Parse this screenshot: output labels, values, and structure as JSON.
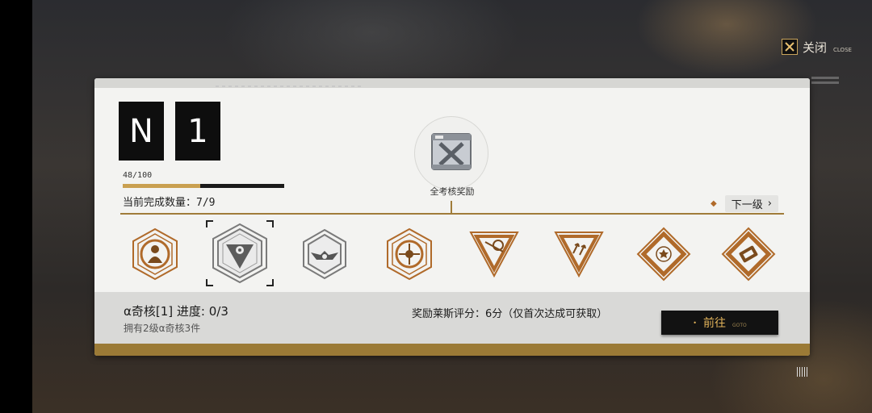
{
  "close": {
    "label": "关闭",
    "sub": "CLOSE",
    "icon": "close-icon"
  },
  "rank": {
    "letter": "N",
    "number": "1"
  },
  "progress": {
    "text": "48/100",
    "current": 48,
    "max": 100
  },
  "completion": {
    "label": "当前完成数量：",
    "value": "7/9"
  },
  "reward": {
    "label": "全考核奖励",
    "icon": "supply-crate-icon"
  },
  "next_level": {
    "label": "下一级",
    "arrow": "›"
  },
  "medals": [
    {
      "name": "person-badge-icon",
      "selected": false
    },
    {
      "name": "triangle-emblem-icon",
      "selected": true
    },
    {
      "name": "wings-emblem-icon",
      "selected": false
    },
    {
      "name": "compass-emblem-icon",
      "selected": false
    },
    {
      "name": "inverted-triangle-emblem-icon",
      "selected": false
    },
    {
      "name": "arrows-triangle-emblem-icon",
      "selected": false
    },
    {
      "name": "star-diamond-emblem-icon",
      "selected": false
    },
    {
      "name": "ticket-diamond-emblem-icon",
      "selected": false
    }
  ],
  "task": {
    "title": "α奇核[1] 进度: 0/3",
    "subtitle": "拥有2级α奇核3件",
    "reward_text": "奖励莱斯评分：6分（仅首次达成可获取）"
  },
  "go_button": {
    "label": "前往",
    "sub": "GOTO"
  },
  "colors": {
    "gold": "#9b7a36",
    "bronze": "#b06a2a",
    "grey": "#7a7a7a"
  }
}
